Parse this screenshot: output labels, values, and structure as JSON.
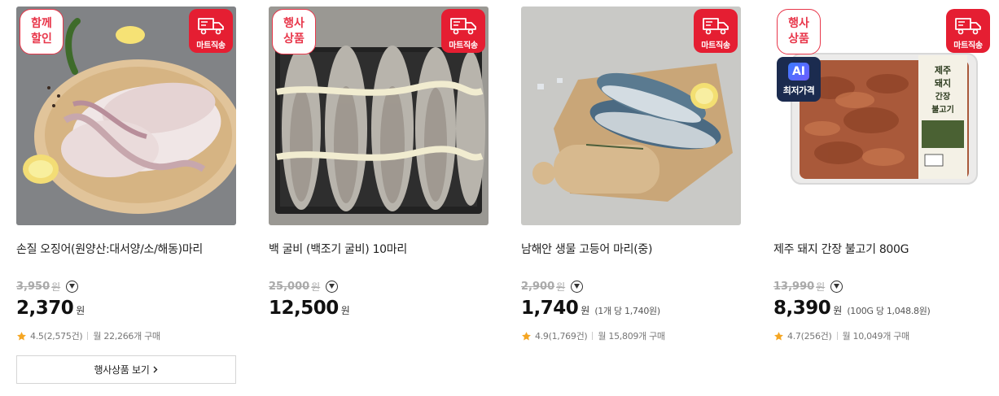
{
  "colors": {
    "accent_red": "#e51e32",
    "event_badge": "#e8364a",
    "ai_badge_bg": "#1b2b4f",
    "star": "#f5a623"
  },
  "products": [
    {
      "name": "손질 오징어(원양산:대서양/소/해동)마리",
      "event_badge": [
        "함께",
        "할인"
      ],
      "delivery_badge": "마트직송",
      "original_price": "3,950",
      "price": "2,370",
      "currency": "원",
      "unit_price": "",
      "rating": "4.5(2,575건)",
      "monthly": "월 22,266개 구매",
      "event_button": "행사상품 보기"
    },
    {
      "name": "백 굴비 (백조기 굴비) 10마리",
      "event_badge": [
        "행사",
        "상품"
      ],
      "delivery_badge": "마트직송",
      "original_price": "25,000",
      "price": "12,500",
      "currency": "원",
      "unit_price": "",
      "rating": "",
      "monthly": ""
    },
    {
      "name": "남해안 생물 고등어 마리(중)",
      "event_badge": [],
      "delivery_badge": "마트직송",
      "original_price": "2,900",
      "price": "1,740",
      "currency": "원",
      "unit_price": "(1개 당 1,740원)",
      "rating": "4.9(1,769건)",
      "monthly": "월 15,809개 구매"
    },
    {
      "name": "제주 돼지 간장 불고기 800G",
      "event_badge": [
        "행사",
        "상품"
      ],
      "delivery_badge": "마트직송",
      "ai_badge": {
        "icon": "AI",
        "label": "최저가격"
      },
      "original_price": "13,990",
      "price": "8,390",
      "currency": "원",
      "unit_price": "(100G 당 1,048.8원)",
      "rating": "4.7(256건)",
      "monthly": "월 10,049개 구매"
    }
  ],
  "icons": {
    "truck": "truck-icon",
    "info": "chevron-down-circle-icon",
    "star": "star-icon",
    "arrow": "chevron-right-icon"
  }
}
